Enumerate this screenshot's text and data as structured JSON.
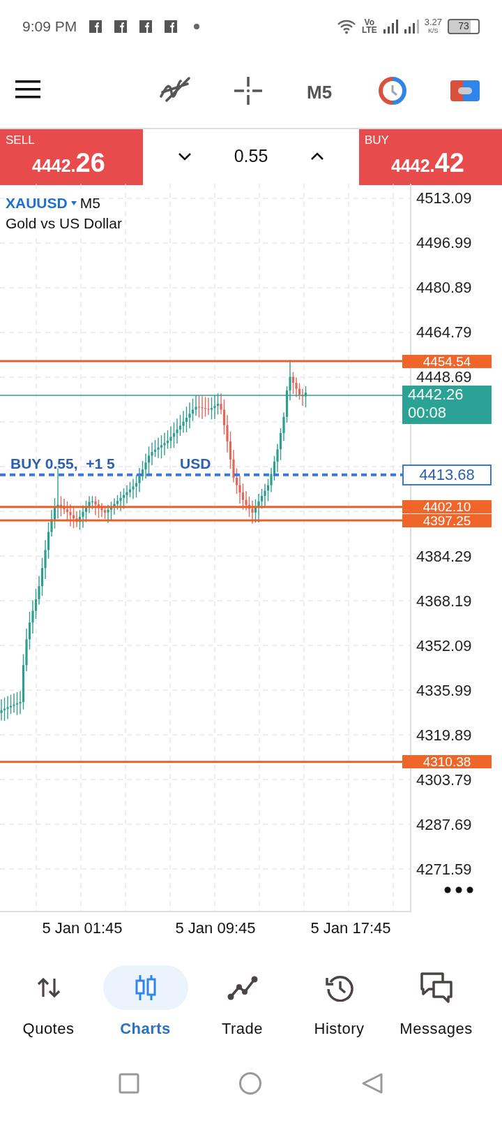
{
  "status_bar": {
    "time": "9:09 PM",
    "volte_top": "Vo",
    "volte_bottom": "LTE",
    "speed": "3.27",
    "speed_unit": "K/S",
    "battery": "73"
  },
  "toolbar": {
    "timeframe": "M5"
  },
  "trade_panel": {
    "sell": {
      "label": "SELL",
      "price_main": "4442.",
      "price_big": "26"
    },
    "volume": "0.55",
    "buy": {
      "label": "BUY",
      "price_main": "4442.",
      "price_big": "42"
    }
  },
  "chart": {
    "symbol": "XAUUSD",
    "timeframe": "M5",
    "description": "Gold vs US Dollar",
    "price_axis": [
      "4513.09",
      "4496.99",
      "4480.89",
      "4464.79",
      "4448.69",
      "4384.29",
      "4368.19",
      "4352.09",
      "4335.99",
      "4319.89",
      "4303.79",
      "4287.69",
      "4271.59"
    ],
    "levels": [
      {
        "kind": "order",
        "label": "4454.54"
      },
      {
        "kind": "bid",
        "label": "4442.26",
        "sublabel": "00:08"
      },
      {
        "kind": "position",
        "label": "4413.68"
      },
      {
        "kind": "order",
        "label": "4402.10"
      },
      {
        "kind": "order",
        "label": "4397.25"
      },
      {
        "kind": "order",
        "label": "4310.38"
      }
    ],
    "position_label": "BUY 0.55,  +1 5",
    "position_unit": "USD",
    "time_axis": [
      "5 Jan 01:45",
      "5 Jan 09:45",
      "5 Jan 17:45"
    ]
  },
  "nav": [
    {
      "label": "Quotes",
      "selected": false
    },
    {
      "label": "Charts",
      "selected": true
    },
    {
      "label": "Trade",
      "selected": false
    },
    {
      "label": "History",
      "selected": false
    },
    {
      "label": "Messages",
      "selected": false
    }
  ]
}
